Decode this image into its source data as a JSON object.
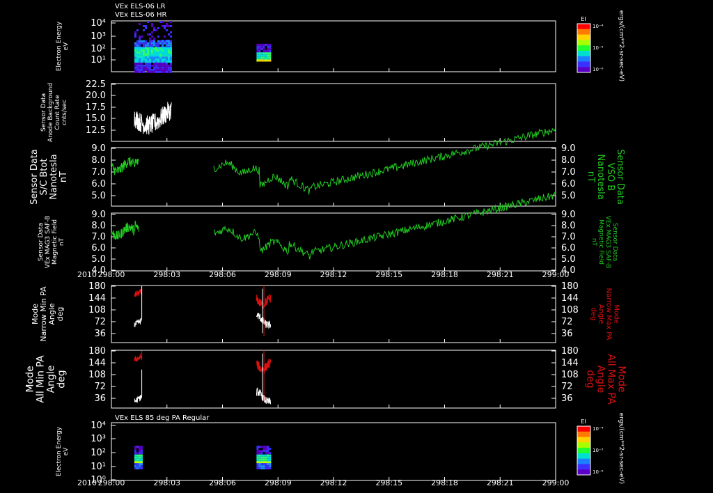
{
  "page": {
    "header_line1": "VEx ELS-06 LR",
    "header_line2": "VEx ELS-06 HR",
    "mid_header": "VEx ELS 85 deg PA Regular",
    "year_label": "2010",
    "colorbar_title": "EI",
    "colorbar_units": "ergs/(cm**2-sr-sec-eV)",
    "colorbar_ticks": [
      "10⁻⁴",
      "10⁻⁵",
      "10⁻⁶"
    ]
  },
  "colors": {
    "background": "#000000",
    "foreground": "#ffffff",
    "green": "#22cc22",
    "red": "#dd1111"
  },
  "chart_data": [
    {
      "type": "heatmap",
      "title": "",
      "ylabel": [
        "Electron Energy",
        "eV"
      ],
      "ylim_log": [
        0.5,
        4.2
      ],
      "y_ticks": [
        "10⁴",
        "10³",
        "10²",
        "10¹"
      ],
      "xlim": [
        0,
        60
      ],
      "blocks": [
        {
          "x_start": 3.1,
          "x_end": 8.1,
          "y_levels": [
            "10¹",
            "10⁴"
          ]
        },
        {
          "x_start": 19.6,
          "x_end": 21.5,
          "y_levels": [
            "10¹",
            "10²"
          ]
        }
      ]
    },
    {
      "type": "line",
      "ylabel": [
        "Sensor Data",
        "Anode Background",
        "Count Rate",
        "cnts/sec"
      ],
      "ylim": [
        12.5,
        22.5
      ],
      "y_ticks": [
        "22.5",
        "20.0",
        "17.5",
        "15.0",
        "12.5"
      ],
      "series": [
        {
          "color": "#ffffff",
          "x_range": [
            3.1,
            8.1
          ]
        }
      ]
    },
    {
      "type": "line",
      "ylabel": [
        "Sensor Data",
        "S/C Btot",
        "Nanotesla",
        "nT"
      ],
      "ylabel_right": [
        "Sensor Data",
        "VSO B",
        "Nanotesla",
        "nT"
      ],
      "ylim": [
        4.0,
        9.0
      ],
      "y_ticks": [
        "9.0",
        "8.0",
        "7.0",
        "6.0",
        "5.0"
      ],
      "series": [
        {
          "color": "#22cc22",
          "x_range": [
            0,
            3.7
          ]
        },
        {
          "color": "#22cc22",
          "x_range": [
            13.8,
            60
          ]
        }
      ]
    },
    {
      "type": "line",
      "ylabel": [
        "Sensor Data",
        "VEx MAG3 SAF-B",
        "Magnetic Field",
        "nT"
      ],
      "ylabel_right": [
        "Sensor Data",
        "VEx MAG3 SAF-B",
        "Magnetic Field",
        "nT"
      ],
      "ylim": [
        4.0,
        9.0
      ],
      "y_ticks": [
        "9.0",
        "8.0",
        "7.0",
        "6.0",
        "5.0",
        "4.0"
      ],
      "series": [
        {
          "color": "#22cc22",
          "x_range": [
            0,
            3.7
          ]
        },
        {
          "color": "#22cc22",
          "x_range": [
            13.8,
            60
          ]
        }
      ]
    },
    {
      "type": "line",
      "ylabel": [
        "Mode",
        "Narrow Min PA",
        "Angle",
        "deg"
      ],
      "ylabel_right": [
        "Mode",
        "Narrow Max PA",
        "Angle",
        "deg"
      ],
      "ylim": [
        0,
        180
      ],
      "y_ticks": [
        "180",
        "144",
        "108",
        "72",
        "36"
      ],
      "series": [
        {
          "name": "min",
          "color": "#ffffff"
        },
        {
          "name": "max",
          "color": "#dd1111"
        }
      ]
    },
    {
      "type": "line",
      "ylabel": [
        "Mode",
        "All Min PA",
        "Angle",
        "deg"
      ],
      "ylabel_right": [
        "Mode",
        "All Max PA",
        "Angle",
        "deg"
      ],
      "ylim": [
        0,
        180
      ],
      "y_ticks": [
        "180",
        "144",
        "108",
        "72",
        "36"
      ],
      "series": [
        {
          "name": "min",
          "color": "#ffffff"
        },
        {
          "name": "max",
          "color": "#dd1111"
        }
      ]
    },
    {
      "type": "heatmap",
      "ylabel": [
        "Electron Energy",
        "eV"
      ],
      "y_ticks": [
        "10⁴",
        "10³",
        "10²",
        "10¹",
        "10⁰"
      ],
      "blocks": [
        {
          "x_start": 3.1,
          "x_end": 4.1
        },
        {
          "x_start": 19.6,
          "x_end": 21.5
        }
      ]
    }
  ],
  "x_axis": {
    "tick_labels": [
      "298:00",
      "298:03",
      "298:06",
      "298:09",
      "298:12",
      "298:15",
      "298:18",
      "298:21",
      "299:00"
    ],
    "range_minutes": [
      0,
      60
    ]
  }
}
